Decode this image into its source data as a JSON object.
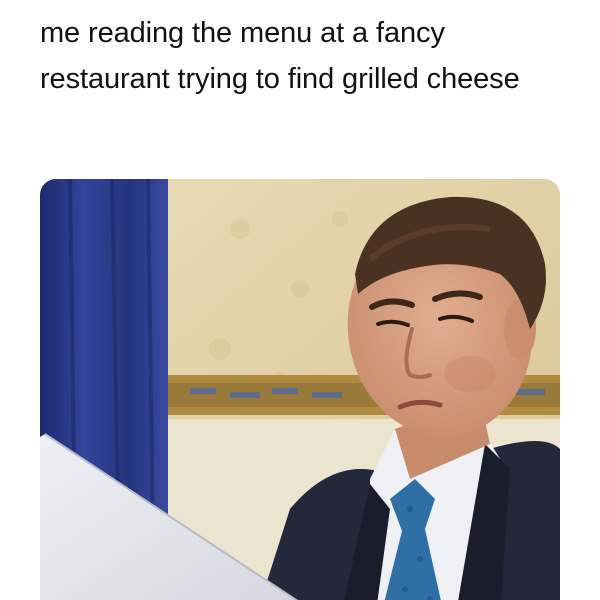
{
  "meme": {
    "caption": "me reading the menu at a fancy restaurant trying to find grilled cheese"
  },
  "photo": {
    "subject": "man-squinting-at-paper",
    "colors": {
      "curtain": "#2b3a8c",
      "wall": "#e3d3a6",
      "trim": "#b08a3e",
      "suit": "#23283a",
      "shirt": "#eef0f4",
      "tie": "#2f6fa6",
      "paper": "#e4e6ec",
      "skin": "#d9a184",
      "hair": "#4a3222"
    }
  }
}
